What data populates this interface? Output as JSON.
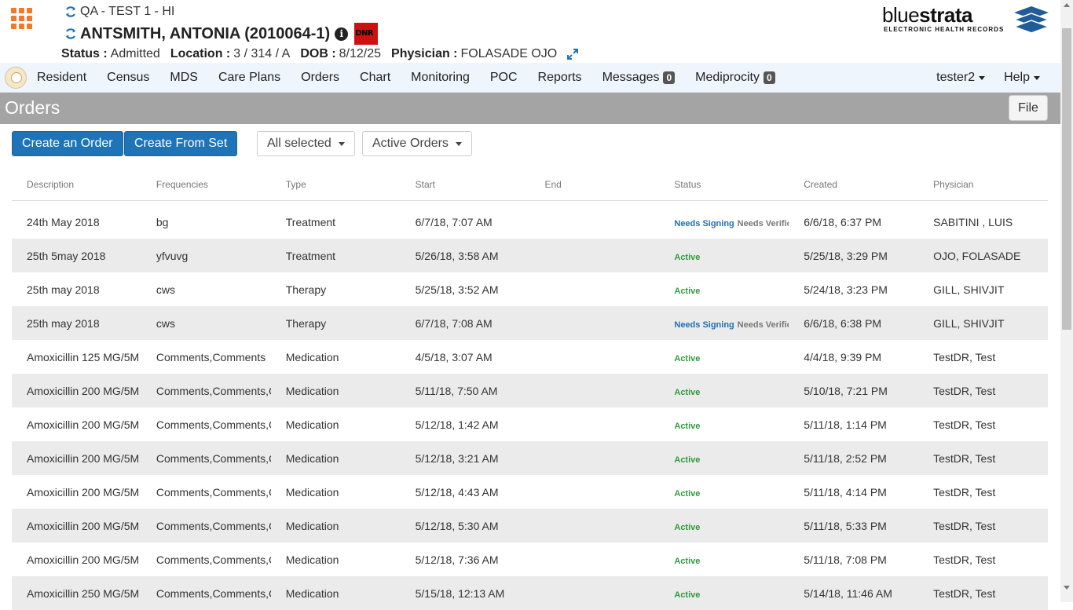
{
  "header": {
    "facility": "QA - TEST 1 - HI",
    "patient_name": "ANTSMITH, ANTONIA (2010064-1)",
    "dnr_label": "DNR",
    "status_label": "Status :",
    "status_value": "Admitted",
    "location_label": "Location :",
    "location_value": "3 / 314 / A",
    "dob_label": "DOB :",
    "dob_value": "8/12/25",
    "physician_label": "Physician :",
    "physician_value": "FOLASADE OJO"
  },
  "logo": {
    "thin": "blue",
    "bold": "strata",
    "sub": "ELECTRONIC HEALTH RECORDS"
  },
  "nav": {
    "items": [
      {
        "label": "Resident"
      },
      {
        "label": "Census"
      },
      {
        "label": "MDS"
      },
      {
        "label": "Care Plans"
      },
      {
        "label": "Orders"
      },
      {
        "label": "Chart"
      },
      {
        "label": "Monitoring"
      },
      {
        "label": "POC"
      },
      {
        "label": "Reports"
      },
      {
        "label": "Messages",
        "badge": "0"
      },
      {
        "label": "Mediprocity",
        "badge": "0"
      }
    ],
    "user": "tester2",
    "help": "Help"
  },
  "page": {
    "title": "Orders",
    "file_button": "File"
  },
  "toolbar": {
    "create_order": "Create an Order",
    "create_from_set": "Create From Set",
    "filter_selected": "All selected",
    "filter_orders": "Active Orders"
  },
  "table": {
    "columns": [
      "Description",
      "Frequencies",
      "Type",
      "Start",
      "End",
      "Status",
      "Created",
      "Physician"
    ],
    "rows": [
      {
        "description": "24th May 2018",
        "frequencies": "bg",
        "type": "Treatment",
        "start": "6/7/18, 7:07 AM",
        "end": "",
        "status": "Needs Signing",
        "status2": "Needs Verific",
        "created": "6/6/18, 6:37 PM",
        "physician": "SABITINI , LUIS"
      },
      {
        "description": "25th 5may 2018",
        "frequencies": "yfvuvg",
        "type": "Treatment",
        "start": "5/26/18, 3:58 AM",
        "end": "",
        "status": "Active",
        "status2": "",
        "created": "5/25/18, 3:29 PM",
        "physician": "OJO, FOLASADE"
      },
      {
        "description": "25th may 2018",
        "frequencies": "cws",
        "type": "Therapy",
        "start": "5/25/18, 3:52 AM",
        "end": "",
        "status": "Active",
        "status2": "",
        "created": "5/24/18, 3:23 PM",
        "physician": "GILL, SHIVJIT"
      },
      {
        "description": "25th may 2018",
        "frequencies": "cws",
        "type": "Therapy",
        "start": "6/7/18, 7:08 AM",
        "end": "",
        "status": "Needs Signing",
        "status2": "Needs Verific",
        "created": "6/6/18, 6:38 PM",
        "physician": "GILL, SHIVJIT"
      },
      {
        "description": "Amoxicillin 125 MG/5M",
        "frequencies": "Comments,Comments",
        "type": "Medication",
        "start": "4/5/18, 3:07 AM",
        "end": "",
        "status": "Active",
        "status2": "",
        "created": "4/4/18, 9:39 PM",
        "physician": "TestDR, Test"
      },
      {
        "description": "Amoxicillin 200 MG/5M",
        "frequencies": "Comments,Comments,C",
        "type": "Medication",
        "start": "5/11/18, 7:50 AM",
        "end": "",
        "status": "Active",
        "status2": "",
        "created": "5/10/18, 7:21 PM",
        "physician": "TestDR, Test"
      },
      {
        "description": "Amoxicillin 200 MG/5M",
        "frequencies": "Comments,Comments,C",
        "type": "Medication",
        "start": "5/12/18, 1:42 AM",
        "end": "",
        "status": "Active",
        "status2": "",
        "created": "5/11/18, 1:14 PM",
        "physician": "TestDR, Test"
      },
      {
        "description": "Amoxicillin 200 MG/5M",
        "frequencies": "Comments,Comments,C",
        "type": "Medication",
        "start": "5/12/18, 3:21 AM",
        "end": "",
        "status": "Active",
        "status2": "",
        "created": "5/11/18, 2:52 PM",
        "physician": "TestDR, Test"
      },
      {
        "description": "Amoxicillin 200 MG/5M",
        "frequencies": "Comments,Comments,C",
        "type": "Medication",
        "start": "5/12/18, 4:43 AM",
        "end": "",
        "status": "Active",
        "status2": "",
        "created": "5/11/18, 4:14 PM",
        "physician": "TestDR, Test"
      },
      {
        "description": "Amoxicillin 200 MG/5M",
        "frequencies": "Comments,Comments,C",
        "type": "Medication",
        "start": "5/12/18, 5:30 AM",
        "end": "",
        "status": "Active",
        "status2": "",
        "created": "5/11/18, 5:33 PM",
        "physician": "TestDR, Test"
      },
      {
        "description": "Amoxicillin 200 MG/5M",
        "frequencies": "Comments,Comments,C",
        "type": "Medication",
        "start": "5/12/18, 7:36 AM",
        "end": "",
        "status": "Active",
        "status2": "",
        "created": "5/11/18, 7:08 PM",
        "physician": "TestDR, Test"
      },
      {
        "description": "Amoxicillin 250 MG/5M",
        "frequencies": "Comments,Comments,C",
        "type": "Medication",
        "start": "5/15/18, 12:13 AM",
        "end": "",
        "status": "Active",
        "status2": "",
        "created": "5/14/18, 11:46 AM",
        "physician": "TestDR, Test"
      }
    ]
  },
  "colors": {
    "accent": "#1f73b7",
    "apps_icon": "#f07a2c",
    "title_bar": "#a4a4a4",
    "status_active": "#2f9a3b",
    "status_needs_signing": "#1f6fb0",
    "dnr": "#cc1111"
  },
  "icons": {
    "apps": "grid-icon",
    "refresh": "refresh-icon",
    "info": "info-icon",
    "expand": "expand-icon"
  }
}
